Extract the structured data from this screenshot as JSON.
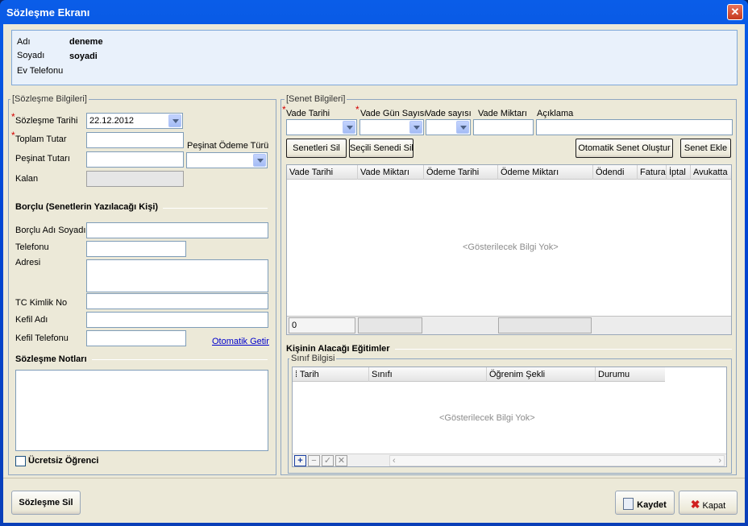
{
  "window": {
    "title": "Sözleşme Ekranı",
    "close_glyph": "✕"
  },
  "info": {
    "adi_label": "Adı",
    "adi_value": "deneme",
    "soyadi_label": "Soyadı",
    "soyadi_value": "soyadi",
    "ev_telefonu_label": "Ev Telefonu"
  },
  "sozlesme": {
    "group_title": "[Sözleşme Bilgileri]",
    "tarih_label": "Sözleşme Tarihi",
    "tarih_value": "22.12.2012",
    "toplam_label": "Toplam Tutar",
    "pesinat_label": "Peşinat Tutarı",
    "pesinat_odeme_label": "Peşinat Ödeme Türü",
    "kalan_label": "Kalan"
  },
  "borclu": {
    "title": "Borçlu (Senetlerin Yazılacağı Kişi)",
    "adi_soyadi_label": "Borçlu Adı Soyadı",
    "telefonu_label": "Telefonu",
    "adresi_label": "Adresi",
    "tc_label": "TC Kimlik No",
    "kefil_adi_label": "Kefil Adı",
    "kefil_tel_label": "Kefil Telefonu",
    "otomatik_getir": "Otomatik Getir"
  },
  "notlar": {
    "title": "Sözleşme Notları"
  },
  "ucretsiz": {
    "label": "Ücretsiz Öğrenci"
  },
  "senet": {
    "group_title": "[Senet Bilgileri]",
    "vade_tarihi_label": "Vade Tarihi",
    "vade_gun_label": "Vade Gün Sayısı",
    "vade_sayisi_label": "Vade sayısı",
    "vade_miktari_label": "Vade Miktarı",
    "aciklama_label": "Açıklama",
    "btn_senetleri_sil": "Senetleri Sil",
    "btn_secili_sil": "Seçili Senedi Sil",
    "btn_otomatik": "Otomatik Senet Oluştur",
    "btn_senet_ekle": "Senet Ekle",
    "columns": [
      "Vade Tarihi",
      "Vade Miktarı",
      "Ödeme Tarihi",
      "Ödeme Miktarı",
      "Ödendi",
      "Fatura",
      "İptal",
      "Avukatta"
    ],
    "empty": "<Gösterilecek Bilgi Yok>",
    "footer_count": "0"
  },
  "egitimler": {
    "title": "Kişinin Alacağı Eğitimler",
    "sinif_group": "Sınıf Bilgisi",
    "columns": [
      "Tarih",
      "Sınıfı",
      "Öğrenim Şekli",
      "Durumu"
    ],
    "empty": "<Gösterilecek Bilgi Yok>",
    "nav": [
      "+",
      "−",
      "✓",
      "✕"
    ]
  },
  "bottom": {
    "sozlesme_sil": "Sözleşme Sil",
    "kaydet": "Kaydet",
    "kapat": "Kapat"
  }
}
